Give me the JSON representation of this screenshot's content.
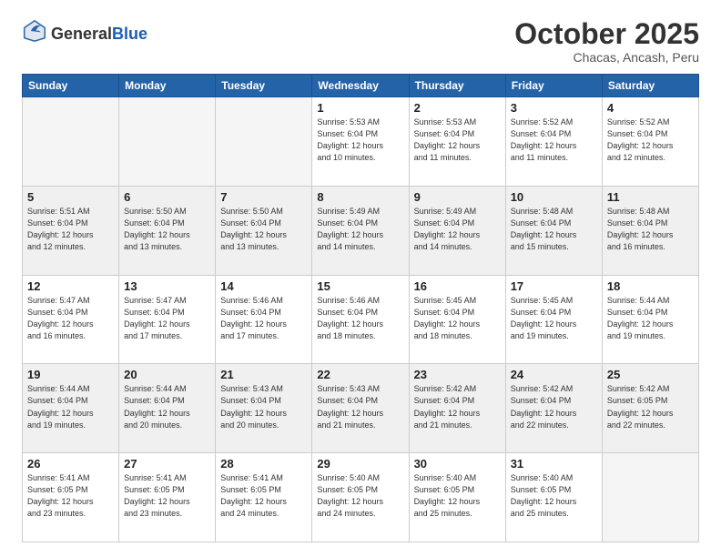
{
  "logo": {
    "text_general": "General",
    "text_blue": "Blue",
    "tagline": ""
  },
  "header": {
    "month_title": "October 2025",
    "subtitle": "Chacas, Ancash, Peru"
  },
  "days_of_week": [
    "Sunday",
    "Monday",
    "Tuesday",
    "Wednesday",
    "Thursday",
    "Friday",
    "Saturday"
  ],
  "weeks": [
    [
      {
        "day": "",
        "info": ""
      },
      {
        "day": "",
        "info": ""
      },
      {
        "day": "",
        "info": ""
      },
      {
        "day": "1",
        "info": "Sunrise: 5:53 AM\nSunset: 6:04 PM\nDaylight: 12 hours\nand 10 minutes."
      },
      {
        "day": "2",
        "info": "Sunrise: 5:53 AM\nSunset: 6:04 PM\nDaylight: 12 hours\nand 11 minutes."
      },
      {
        "day": "3",
        "info": "Sunrise: 5:52 AM\nSunset: 6:04 PM\nDaylight: 12 hours\nand 11 minutes."
      },
      {
        "day": "4",
        "info": "Sunrise: 5:52 AM\nSunset: 6:04 PM\nDaylight: 12 hours\nand 12 minutes."
      }
    ],
    [
      {
        "day": "5",
        "info": "Sunrise: 5:51 AM\nSunset: 6:04 PM\nDaylight: 12 hours\nand 12 minutes."
      },
      {
        "day": "6",
        "info": "Sunrise: 5:50 AM\nSunset: 6:04 PM\nDaylight: 12 hours\nand 13 minutes."
      },
      {
        "day": "7",
        "info": "Sunrise: 5:50 AM\nSunset: 6:04 PM\nDaylight: 12 hours\nand 13 minutes."
      },
      {
        "day": "8",
        "info": "Sunrise: 5:49 AM\nSunset: 6:04 PM\nDaylight: 12 hours\nand 14 minutes."
      },
      {
        "day": "9",
        "info": "Sunrise: 5:49 AM\nSunset: 6:04 PM\nDaylight: 12 hours\nand 14 minutes."
      },
      {
        "day": "10",
        "info": "Sunrise: 5:48 AM\nSunset: 6:04 PM\nDaylight: 12 hours\nand 15 minutes."
      },
      {
        "day": "11",
        "info": "Sunrise: 5:48 AM\nSunset: 6:04 PM\nDaylight: 12 hours\nand 16 minutes."
      }
    ],
    [
      {
        "day": "12",
        "info": "Sunrise: 5:47 AM\nSunset: 6:04 PM\nDaylight: 12 hours\nand 16 minutes."
      },
      {
        "day": "13",
        "info": "Sunrise: 5:47 AM\nSunset: 6:04 PM\nDaylight: 12 hours\nand 17 minutes."
      },
      {
        "day": "14",
        "info": "Sunrise: 5:46 AM\nSunset: 6:04 PM\nDaylight: 12 hours\nand 17 minutes."
      },
      {
        "day": "15",
        "info": "Sunrise: 5:46 AM\nSunset: 6:04 PM\nDaylight: 12 hours\nand 18 minutes."
      },
      {
        "day": "16",
        "info": "Sunrise: 5:45 AM\nSunset: 6:04 PM\nDaylight: 12 hours\nand 18 minutes."
      },
      {
        "day": "17",
        "info": "Sunrise: 5:45 AM\nSunset: 6:04 PM\nDaylight: 12 hours\nand 19 minutes."
      },
      {
        "day": "18",
        "info": "Sunrise: 5:44 AM\nSunset: 6:04 PM\nDaylight: 12 hours\nand 19 minutes."
      }
    ],
    [
      {
        "day": "19",
        "info": "Sunrise: 5:44 AM\nSunset: 6:04 PM\nDaylight: 12 hours\nand 19 minutes."
      },
      {
        "day": "20",
        "info": "Sunrise: 5:44 AM\nSunset: 6:04 PM\nDaylight: 12 hours\nand 20 minutes."
      },
      {
        "day": "21",
        "info": "Sunrise: 5:43 AM\nSunset: 6:04 PM\nDaylight: 12 hours\nand 20 minutes."
      },
      {
        "day": "22",
        "info": "Sunrise: 5:43 AM\nSunset: 6:04 PM\nDaylight: 12 hours\nand 21 minutes."
      },
      {
        "day": "23",
        "info": "Sunrise: 5:42 AM\nSunset: 6:04 PM\nDaylight: 12 hours\nand 21 minutes."
      },
      {
        "day": "24",
        "info": "Sunrise: 5:42 AM\nSunset: 6:04 PM\nDaylight: 12 hours\nand 22 minutes."
      },
      {
        "day": "25",
        "info": "Sunrise: 5:42 AM\nSunset: 6:05 PM\nDaylight: 12 hours\nand 22 minutes."
      }
    ],
    [
      {
        "day": "26",
        "info": "Sunrise: 5:41 AM\nSunset: 6:05 PM\nDaylight: 12 hours\nand 23 minutes."
      },
      {
        "day": "27",
        "info": "Sunrise: 5:41 AM\nSunset: 6:05 PM\nDaylight: 12 hours\nand 23 minutes."
      },
      {
        "day": "28",
        "info": "Sunrise: 5:41 AM\nSunset: 6:05 PM\nDaylight: 12 hours\nand 24 minutes."
      },
      {
        "day": "29",
        "info": "Sunrise: 5:40 AM\nSunset: 6:05 PM\nDaylight: 12 hours\nand 24 minutes."
      },
      {
        "day": "30",
        "info": "Sunrise: 5:40 AM\nSunset: 6:05 PM\nDaylight: 12 hours\nand 25 minutes."
      },
      {
        "day": "31",
        "info": "Sunrise: 5:40 AM\nSunset: 6:05 PM\nDaylight: 12 hours\nand 25 minutes."
      },
      {
        "day": "",
        "info": ""
      }
    ]
  ]
}
